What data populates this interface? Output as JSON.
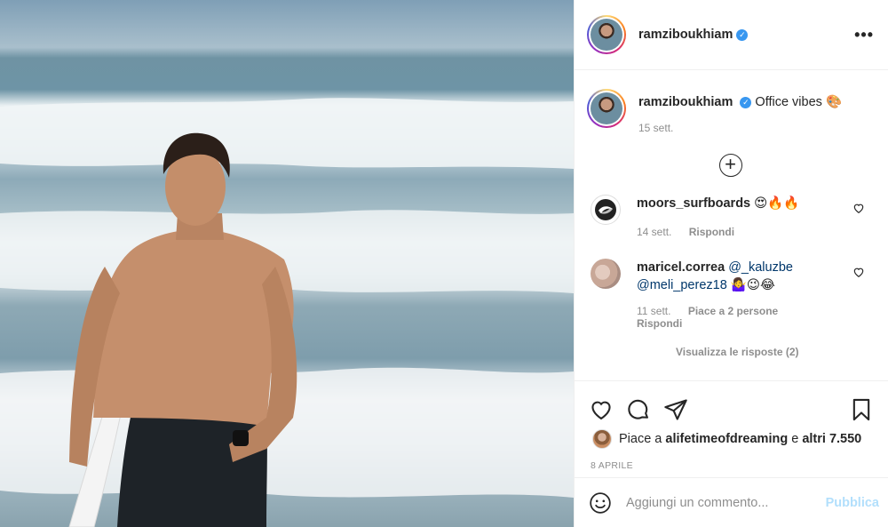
{
  "post": {
    "author": "ramziboukhiam",
    "verified": true,
    "caption": "Office vibes",
    "caption_time": "15 sett.",
    "more_label": "•••"
  },
  "comments": [
    {
      "user": "moors_surfboards",
      "text": "😍🔥🔥",
      "time": "14 sett.",
      "reply_label": "Rispondi"
    },
    {
      "user": "maricel.correa",
      "mention1": "@_kaluzbe",
      "mention2": "@meli_perez18",
      "text": "🤷‍♀️😉😂",
      "time": "11 sett.",
      "likes_label": "Piace a 2 persone",
      "reply_label": "Rispondi"
    }
  ],
  "view_replies": "Visualizza le risposte (2)",
  "likes": {
    "prefix": "Piace a",
    "user": "alifetimeofdreaming",
    "middle": "e",
    "count": "altri 7.550"
  },
  "post_date": "8 APRILE",
  "composer": {
    "placeholder": "Aggiungi un commento...",
    "publish_label": "Pubblica"
  },
  "icons": [
    "heart-icon",
    "comment-icon",
    "share-icon",
    "bookmark-icon",
    "emoji-icon",
    "verified-icon",
    "add-circle-icon"
  ],
  "colors": {
    "verified": "#3897f0",
    "mention": "#00376b",
    "publish_disabled": "#b2dffc",
    "muted": "#8e8e8e"
  }
}
